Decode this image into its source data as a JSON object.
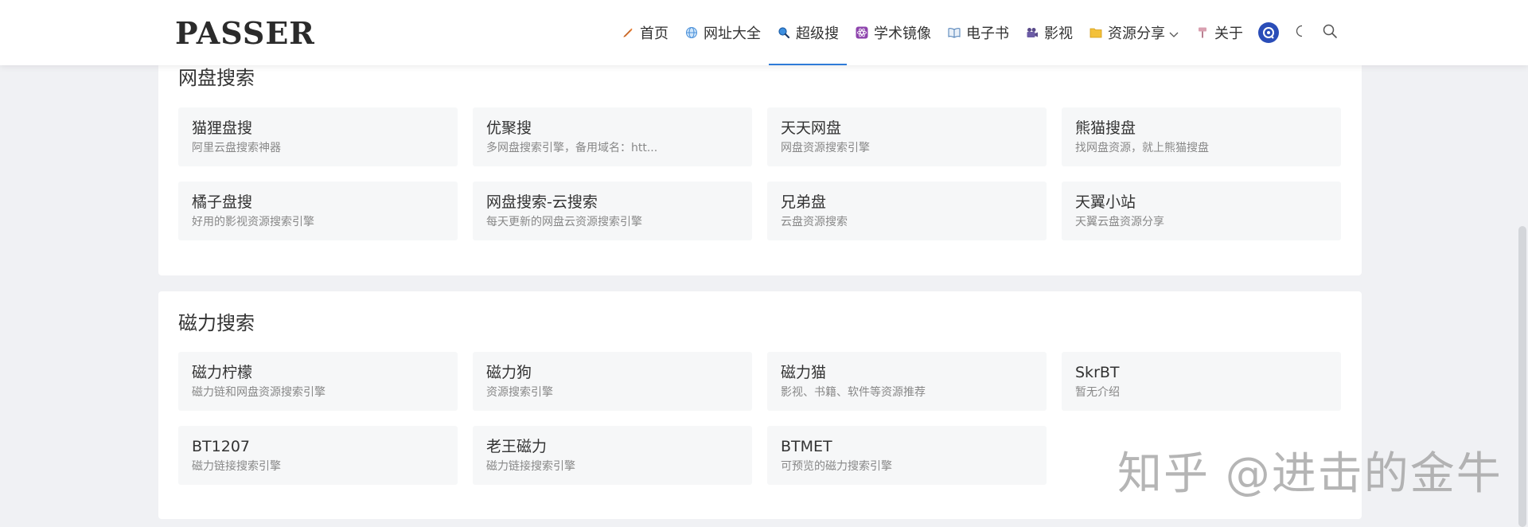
{
  "header": {
    "logo": "PASSER",
    "nav": [
      {
        "label": "首页",
        "icon": "feather-icon"
      },
      {
        "label": "网址大全",
        "icon": "globe-icon"
      },
      {
        "label": "超级搜",
        "icon": "search-icon"
      },
      {
        "label": "学术镜像",
        "icon": "atom-icon"
      },
      {
        "label": "电子书",
        "icon": "book-icon"
      },
      {
        "label": "影视",
        "icon": "camera-icon"
      },
      {
        "label": "资源分享",
        "icon": "folder-icon"
      },
      {
        "label": "关于",
        "icon": "pin-icon"
      }
    ],
    "active_nav": "超级搜"
  },
  "sections": [
    {
      "title": "网盘搜索",
      "items": [
        {
          "name": "猫狸盘搜",
          "desc": "阿里云盘搜索神器"
        },
        {
          "name": "优聚搜",
          "desc": "多网盘搜索引擎，备用域名：htt..."
        },
        {
          "name": "天天网盘",
          "desc": "网盘资源搜索引擎"
        },
        {
          "name": "熊猫搜盘",
          "desc": "找网盘资源，就上熊猫搜盘"
        },
        {
          "name": "橘子盘搜",
          "desc": "好用的影视资源搜索引擎"
        },
        {
          "name": "网盘搜索-云搜索",
          "desc": "每天更新的网盘云资源搜索引擎"
        },
        {
          "name": "兄弟盘",
          "desc": "云盘资源搜索"
        },
        {
          "name": "天翼小站",
          "desc": "天翼云盘资源分享"
        }
      ]
    },
    {
      "title": "磁力搜索",
      "items": [
        {
          "name": "磁力柠檬",
          "desc": "磁力链和网盘资源搜索引擎"
        },
        {
          "name": "磁力狗",
          "desc": "资源搜索引擎"
        },
        {
          "name": "磁力猫",
          "desc": "影视、书籍、软件等资源推荐"
        },
        {
          "name": "SkrBT",
          "desc": "暂无介绍"
        },
        {
          "name": "BT1207",
          "desc": "磁力链接搜索引擎"
        },
        {
          "name": "老王磁力",
          "desc": "磁力链接搜索引擎"
        },
        {
          "name": "BTMET",
          "desc": "可预览的磁力搜索引擎"
        }
      ]
    }
  ],
  "watermark": "知乎 @进击的金牛",
  "colors": {
    "accent": "#2f7bd8",
    "card_bg": "#f6f7f8",
    "page_bg": "#f0f1f4"
  }
}
